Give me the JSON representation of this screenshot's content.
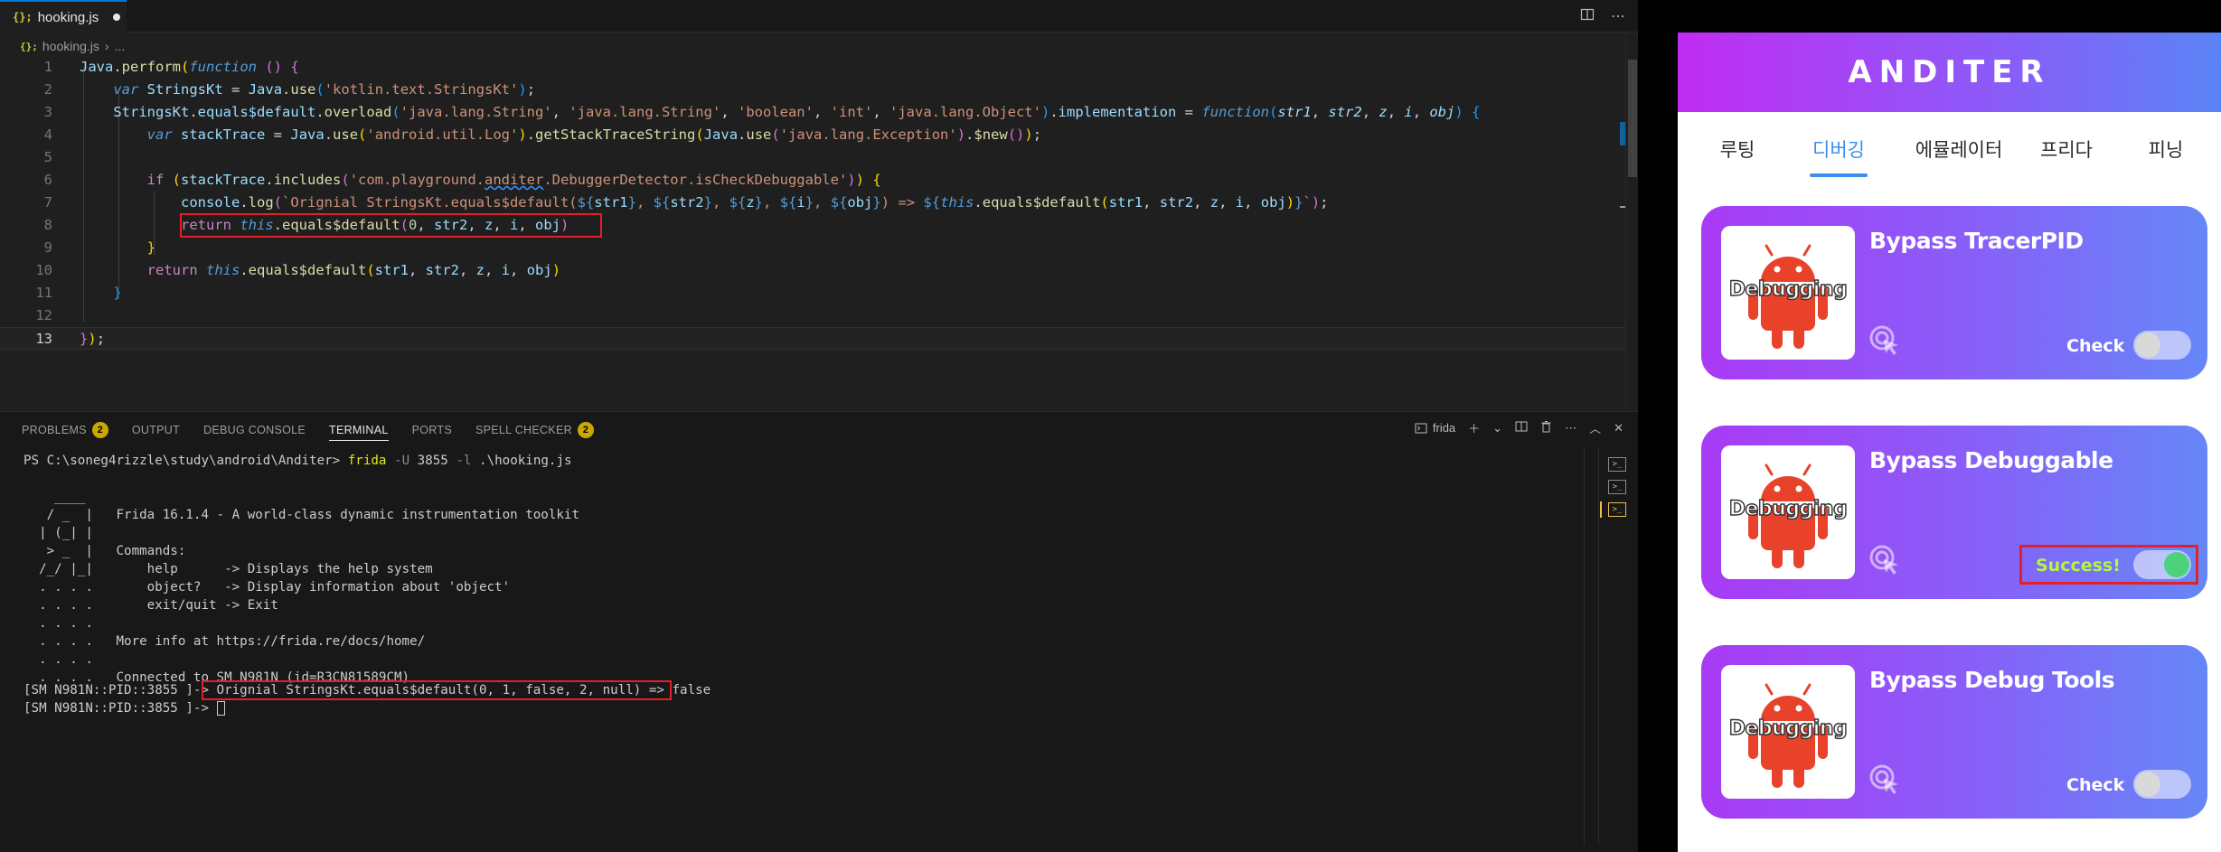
{
  "vscode": {
    "tab": {
      "icon": "js-file-icon",
      "badge": "{};",
      "filename": "hooking.js"
    },
    "breadcrumb": {
      "badge": "{};",
      "file": "hooking.js",
      "more": "..."
    },
    "code": {
      "line_numbers": [
        "1",
        "2",
        "3",
        "4",
        "5",
        "6",
        "7",
        "8",
        "9",
        "10",
        "11",
        "12",
        "13"
      ]
    },
    "panel": {
      "tabs": [
        {
          "label": "PROBLEMS",
          "count": "2"
        },
        {
          "label": "OUTPUT"
        },
        {
          "label": "DEBUG CONSOLE"
        },
        {
          "label": "TERMINAL"
        },
        {
          "label": "PORTS"
        },
        {
          "label": "SPELL CHECKER",
          "count": "2"
        }
      ],
      "active_tab": "TERMINAL",
      "terminal_name": "frida",
      "terminal": {
        "prompt": "PS C:\\soneg4rizzle\\study\\android\\Anditer>",
        "cmd": "frida",
        "args_1": "-U",
        "arg_pid": "3855",
        "args_2": "-l",
        "arg_script": ".\\hooking.js",
        "banner": [
          "    ____",
          "   / _  |   Frida 16.1.4 - A world-class dynamic instrumentation toolkit",
          "  | (_| |",
          "   > _  |   Commands:",
          "  /_/ |_|       help      -> Displays the help system",
          "  . . . .       object?   -> Display information about 'object'",
          "  . . . .       exit/quit -> Exit",
          "  . . . .",
          "  . . . .   More info at https://frida.re/docs/home/",
          "  . . . .",
          "  . . . .   Connected to SM N981N (id=R3CN81589CM)"
        ],
        "session_prompt": "[SM N981N::PID::3855 ]->",
        "output_line": "Orignial StringsKt.equals$default(0, 1, false, 2, null) => false"
      }
    }
  },
  "app": {
    "title": "ANDITER",
    "nav": [
      {
        "label": "루팅"
      },
      {
        "label": "디버깅"
      },
      {
        "label": "에뮬레이터"
      },
      {
        "label": "프리다"
      },
      {
        "label": "피닝"
      }
    ],
    "active_nav": "디버깅",
    "cards": [
      {
        "title": "Bypass TracerPID",
        "image_label": "Debugging",
        "status": "Check",
        "on": false
      },
      {
        "title": "Bypass Debuggable",
        "image_label": "Debugging",
        "status": "Success!",
        "on": true
      },
      {
        "title": "Bypass Debug Tools",
        "image_label": "Debugging",
        "status": "Check",
        "on": false
      }
    ],
    "colors": {
      "header_start": "#c12cf2",
      "header_end": "#5a84f6",
      "nav_active": "#3a8ef0",
      "success_text": "#b6f542",
      "toggle_on": "#4cd27a",
      "highlight_box": "#e0202a"
    }
  }
}
